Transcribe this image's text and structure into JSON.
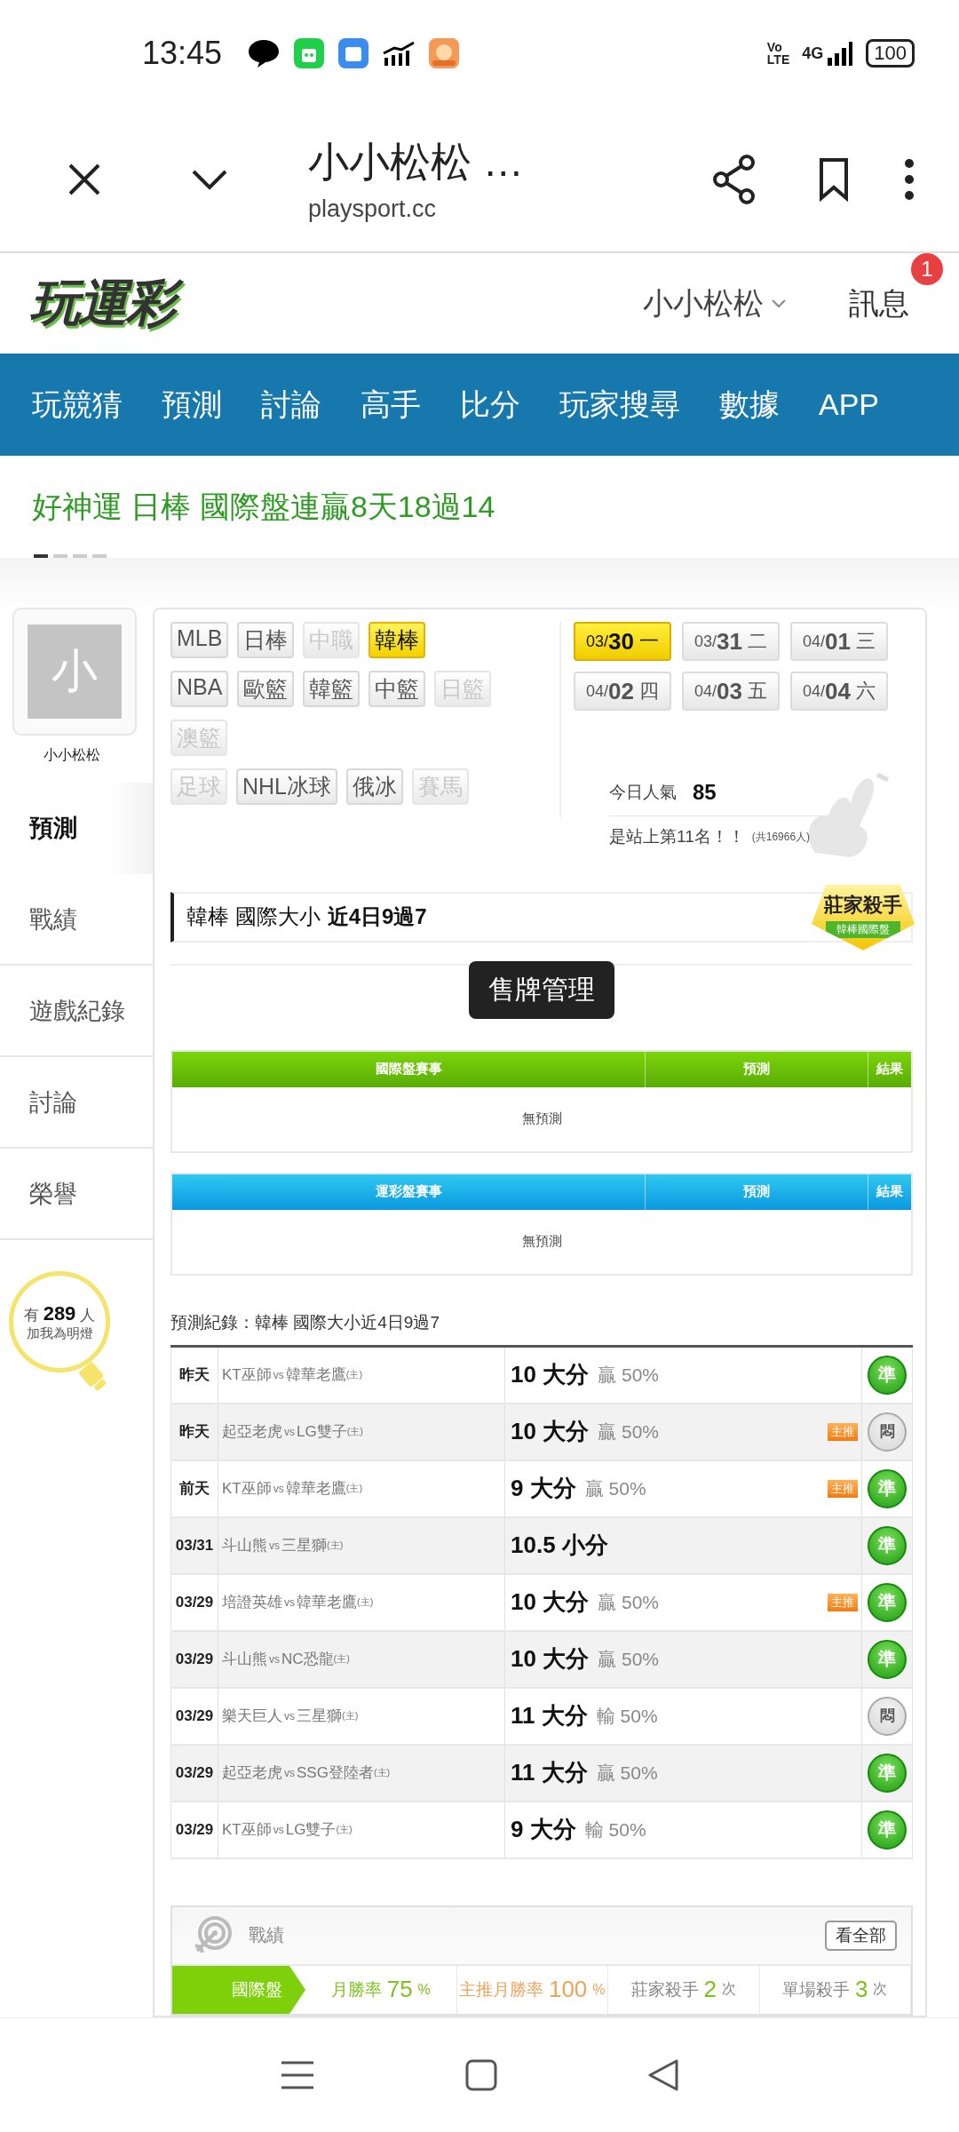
{
  "status_bar": {
    "time": "13:45",
    "volte": [
      "Vo",
      "LTE"
    ],
    "network": "4G",
    "battery": "100"
  },
  "browser": {
    "title": "小小松松 …",
    "url": "playsport.cc"
  },
  "site_header": {
    "logo": "玩運彩",
    "user": "小小松松",
    "messages": "訊息",
    "message_badge": "1"
  },
  "nav": [
    "玩競猜",
    "預測",
    "討論",
    "高手",
    "比分",
    "玩家搜尋",
    "數據",
    "APP"
  ],
  "banner": {
    "text": "好神運 日棒 國際盤連贏8天18過14",
    "pages": [
      {
        "selected": true
      },
      {
        "selected": false
      },
      {
        "selected": false
      },
      {
        "selected": false
      }
    ]
  },
  "profile": {
    "avatar_letter": "小",
    "name": "小小松松",
    "menu": [
      {
        "label": "預測",
        "selected": true
      },
      {
        "label": "戰績",
        "selected": false
      },
      {
        "label": "遊戲紀錄",
        "selected": false
      },
      {
        "label": "討論",
        "selected": false
      },
      {
        "label": "榮譽",
        "selected": false
      }
    ],
    "fans": {
      "prefix": "有",
      "count": "289",
      "suffix": "人",
      "caption": "加我為明燈"
    }
  },
  "leagues": [
    [
      {
        "label": "MLB",
        "selected": false,
        "disabled": false
      },
      {
        "label": "日棒",
        "selected": false,
        "disabled": false
      },
      {
        "label": "中職",
        "selected": false,
        "disabled": true
      },
      {
        "label": "韓棒",
        "selected": true,
        "disabled": false
      }
    ],
    [
      {
        "label": "NBA",
        "selected": false,
        "disabled": false
      },
      {
        "label": "歐籃",
        "selected": false,
        "disabled": false
      },
      {
        "label": "韓籃",
        "selected": false,
        "disabled": false
      },
      {
        "label": "中籃",
        "selected": false,
        "disabled": false
      },
      {
        "label": "日籃",
        "selected": false,
        "disabled": true
      }
    ],
    [
      {
        "label": "澳籃",
        "selected": false,
        "disabled": true
      }
    ],
    [
      {
        "label": "足球",
        "selected": false,
        "disabled": true
      },
      {
        "label": "NHL冰球",
        "selected": false,
        "disabled": false
      },
      {
        "label": "俄冰",
        "selected": false,
        "disabled": false
      },
      {
        "label": "賽馬",
        "selected": false,
        "disabled": true
      }
    ]
  ],
  "dates": [
    {
      "month": "03/",
      "day": "30",
      "weekday": "一",
      "selected": true
    },
    {
      "month": "03/",
      "day": "31",
      "weekday": "二",
      "selected": false
    },
    {
      "month": "04/",
      "day": "01",
      "weekday": "三",
      "selected": false
    },
    {
      "month": "04/",
      "day": "02",
      "weekday": "四",
      "selected": false
    },
    {
      "month": "04/",
      "day": "03",
      "weekday": "五",
      "selected": false
    },
    {
      "month": "04/",
      "day": "04",
      "weekday": "六",
      "selected": false
    }
  ],
  "popularity": {
    "label": "今日人氣",
    "value": "85",
    "rank": "是站上第11名！！",
    "total": "(共16966人)"
  },
  "title_bar": {
    "league": "韓棒 國際大小",
    "streak": "近4日9過7"
  },
  "award": {
    "title": "莊家殺手",
    "subtitle": "韓棒國際盤"
  },
  "sell_button": "售牌管理",
  "tables": [
    {
      "kind": "international",
      "columns": [
        "國際盤賽事",
        "預測",
        "結果"
      ],
      "empty": "無預測"
    },
    {
      "kind": "lottery",
      "columns": [
        "運彩盤賽事",
        "預測",
        "結果"
      ],
      "empty": "無預測"
    }
  ],
  "records": {
    "label": "預測紀錄：韓棒 國際大小近4日9過7",
    "rows": [
      {
        "date": "昨天",
        "away": "KT巫師",
        "vs": "vs",
        "home": "韓華老鷹",
        "home_mark": "(主)",
        "line": "10 大分",
        "result": "贏 50%",
        "featured": false,
        "mark": "準",
        "hit": true
      },
      {
        "date": "昨天",
        "away": "起亞老虎",
        "vs": "vs",
        "home": "LG雙子",
        "home_mark": "(主)",
        "line": "10 大分",
        "result": "贏 50%",
        "featured": true,
        "tag": "主推",
        "mark": "悶",
        "hit": false
      },
      {
        "date": "前天",
        "away": "KT巫師",
        "vs": "vs",
        "home": "韓華老鷹",
        "home_mark": "(主)",
        "line": "9 大分",
        "result": "贏 50%",
        "featured": true,
        "tag": "主推",
        "mark": "準",
        "hit": true
      },
      {
        "date": "03/31",
        "away": "斗山熊",
        "vs": "vs",
        "home": "三星獅",
        "home_mark": "(主)",
        "line": "10.5 小分",
        "featured": false,
        "mark": "準",
        "hit": true
      },
      {
        "date": "03/29",
        "away": "培證英雄",
        "vs": "vs",
        "home": "韓華老鷹",
        "home_mark": "(主)",
        "line": "10 大分",
        "result": "贏 50%",
        "featured": true,
        "tag": "主推",
        "mark": "準",
        "hit": true
      },
      {
        "date": "03/29",
        "away": "斗山熊",
        "vs": "vs",
        "home": "NC恐龍",
        "home_mark": "(主)",
        "line": "10 大分",
        "result": "贏 50%",
        "featured": false,
        "mark": "準",
        "hit": true
      },
      {
        "date": "03/29",
        "away": "樂天巨人",
        "vs": "vs",
        "home": "三星獅",
        "home_mark": "(主)",
        "line": "11 大分",
        "result": "輸 50%",
        "featured": false,
        "mark": "悶",
        "hit": false
      },
      {
        "date": "03/29",
        "away": "起亞老虎",
        "vs": "vs",
        "home": "SSG登陸者",
        "home_mark": "(主)",
        "line": "11 大分",
        "result": "贏 50%",
        "featured": false,
        "mark": "準",
        "hit": true
      },
      {
        "date": "03/29",
        "away": "KT巫師",
        "vs": "vs",
        "home": "LG雙子",
        "home_mark": "(主)",
        "line": "9 大分",
        "result": "輸 50%",
        "featured": false,
        "mark": "準",
        "hit": true
      }
    ]
  },
  "stats": {
    "title": "戰績",
    "view_all": "看全部",
    "tab": "國際盤",
    "items": [
      {
        "kind": "rate",
        "label": "月勝率",
        "value": "75",
        "unit": "%",
        "color": "#7cc219"
      },
      {
        "kind": "rate",
        "label": "主推月勝率",
        "value": "100",
        "unit": "%",
        "color": "#eea35a"
      },
      {
        "kind": "count",
        "label": "莊家殺手",
        "value": "2",
        "unit": "次",
        "color": "#7cc219"
      },
      {
        "kind": "count",
        "label": "單場殺手",
        "value": "3",
        "unit": "次",
        "color": "#7cc219"
      }
    ]
  }
}
